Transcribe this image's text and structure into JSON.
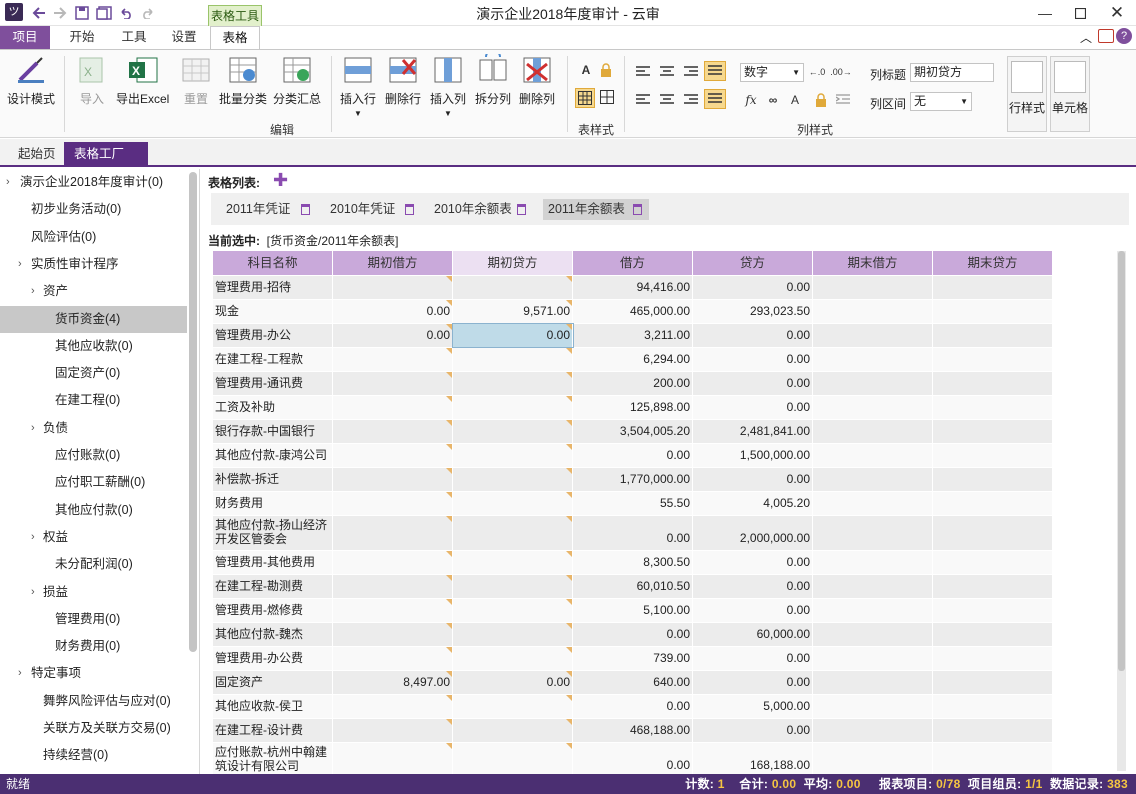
{
  "window": {
    "title": "演示企业2018年度审计 - 云审",
    "context_tab": "表格工具",
    "app_icon": "logo-icon"
  },
  "ribbon_tabs": [
    "项目",
    "开始",
    "工具",
    "设置",
    "表格"
  ],
  "ribbon": {
    "design_mode": "设计模式",
    "import": "导入",
    "export_excel": "导出Excel",
    "reset": "重置",
    "batch_classify": "批量分类",
    "classify_summary": "分类汇总",
    "insert_row": "插入行",
    "delete_row": "删除行",
    "insert_col": "插入列",
    "split_col": "拆分列",
    "delete_col": "删除列",
    "group_edit": "编辑",
    "group_table_style": "表样式",
    "group_col_style": "列样式",
    "format_select": "数字",
    "col_title_label": "列标题",
    "col_title_value": "期初贷方",
    "col_range_label": "列区间",
    "col_range_value": "无",
    "row_style": "行样式",
    "cell_style": "单元格",
    "bold_a": "A",
    "font_a": "A"
  },
  "doc_tabs": [
    "起始页",
    "表格工厂"
  ],
  "sidebar": {
    "items": [
      {
        "label": "演示企业2018年度审计(0)",
        "level": 0,
        "arrow": "›"
      },
      {
        "label": "初步业务活动(0)",
        "level": 1,
        "arrow": ""
      },
      {
        "label": "风险评估(0)",
        "level": 1,
        "arrow": ""
      },
      {
        "label": "实质性审计程序",
        "level": 1,
        "arrow": "›"
      },
      {
        "label": "资产",
        "level": 2,
        "arrow": "›"
      },
      {
        "label": "货币资金(4)",
        "level": 3,
        "arrow": "",
        "selected": true
      },
      {
        "label": "其他应收款(0)",
        "level": 3,
        "arrow": ""
      },
      {
        "label": "固定资产(0)",
        "level": 3,
        "arrow": ""
      },
      {
        "label": "在建工程(0)",
        "level": 3,
        "arrow": ""
      },
      {
        "label": "负债",
        "level": 2,
        "arrow": "›"
      },
      {
        "label": "应付账款(0)",
        "level": 3,
        "arrow": ""
      },
      {
        "label": "应付职工薪酬(0)",
        "level": 3,
        "arrow": ""
      },
      {
        "label": "其他应付款(0)",
        "level": 3,
        "arrow": ""
      },
      {
        "label": "权益",
        "level": 2,
        "arrow": "›"
      },
      {
        "label": "未分配利润(0)",
        "level": 3,
        "arrow": ""
      },
      {
        "label": "损益",
        "level": 2,
        "arrow": "›"
      },
      {
        "label": "管理费用(0)",
        "level": 3,
        "arrow": ""
      },
      {
        "label": "财务费用(0)",
        "level": 3,
        "arrow": ""
      },
      {
        "label": "特定事项",
        "level": 1,
        "arrow": "›"
      },
      {
        "label": "舞弊风险评估与应对(0)",
        "level": 2,
        "arrow": ""
      },
      {
        "label": "关联方及关联方交易(0)",
        "level": 2,
        "arrow": ""
      },
      {
        "label": "持续经营(0)",
        "level": 2,
        "arrow": ""
      }
    ]
  },
  "main": {
    "table_list_label": "表格列表:",
    "add_icon": "plus-icon",
    "table_tabs": [
      {
        "label": "2011年凭证",
        "active": false
      },
      {
        "label": "2010年凭证",
        "active": false
      },
      {
        "label": "2010年余额表",
        "active": false
      },
      {
        "label": "2011年余额表",
        "active": true
      }
    ],
    "current_label": "当前选中:",
    "current_value": "[货币资金/2011年余额表]"
  },
  "grid": {
    "columns": [
      "科目名称",
      "期初借方",
      "期初贷方",
      "借方",
      "贷方",
      "期末借方",
      "期末贷方"
    ],
    "selected_column": 2,
    "rows": [
      [
        "管理费用-招待",
        "",
        "",
        "94,416.00",
        "0.00",
        "",
        ""
      ],
      [
        "现金",
        "0.00",
        "9,571.00",
        "465,000.00",
        "293,023.50",
        "",
        ""
      ],
      [
        "管理费用-办公",
        "0.00",
        "0.00",
        "3,211.00",
        "0.00",
        "",
        ""
      ],
      [
        "在建工程-工程款",
        "",
        "",
        "6,294.00",
        "0.00",
        "",
        ""
      ],
      [
        "管理费用-通讯费",
        "",
        "",
        "200.00",
        "0.00",
        "",
        ""
      ],
      [
        "工资及补助",
        "",
        "",
        "125,898.00",
        "0.00",
        "",
        ""
      ],
      [
        "银行存款-中国银行",
        "",
        "",
        "3,504,005.20",
        "2,481,841.00",
        "",
        ""
      ],
      [
        "其他应付款-康鸿公司",
        "",
        "",
        "0.00",
        "1,500,000.00",
        "",
        ""
      ],
      [
        "补偿款-拆迁",
        "",
        "",
        "1,770,000.00",
        "0.00",
        "",
        ""
      ],
      [
        "财务费用",
        "",
        "",
        "55.50",
        "4,005.20",
        "",
        ""
      ],
      [
        "其他应付款-扬山经济开发区管委会",
        "",
        "",
        "0.00",
        "2,000,000.00",
        "",
        ""
      ],
      [
        "管理费用-其他费用",
        "",
        "",
        "8,300.50",
        "0.00",
        "",
        ""
      ],
      [
        "在建工程-勘测费",
        "",
        "",
        "60,010.50",
        "0.00",
        "",
        ""
      ],
      [
        "管理费用-燃修费",
        "",
        "",
        "5,100.00",
        "0.00",
        "",
        ""
      ],
      [
        "其他应付款-魏杰",
        "",
        "",
        "0.00",
        "60,000.00",
        "",
        ""
      ],
      [
        "管理费用-办公费",
        "",
        "",
        "739.00",
        "0.00",
        "",
        ""
      ],
      [
        "固定资产",
        "8,497.00",
        "0.00",
        "640.00",
        "0.00",
        "",
        ""
      ],
      [
        "其他应收款-侯卫",
        "",
        "",
        "0.00",
        "5,000.00",
        "",
        ""
      ],
      [
        "在建工程-设计费",
        "",
        "",
        "468,188.00",
        "0.00",
        "",
        ""
      ],
      [
        "应付账款-杭州中翰建筑设计有限公司",
        "",
        "",
        "0.00",
        "168,188.00",
        "",
        ""
      ]
    ]
  },
  "status": {
    "left": "就绪",
    "count_label": "计数:",
    "count": "1",
    "sum_label": "合计:",
    "sum": "0.00",
    "avg_label": "平均:",
    "avg": "0.00",
    "report_label": "报表项目:",
    "report": "0/78",
    "group_label": "项目组员:",
    "group": "1/1",
    "records_label": "数据记录:",
    "records": "383"
  },
  "colors": {
    "brand": "#7f4f9c",
    "header": "#c9a9da",
    "status": "#4b2f72",
    "active_cell": "#bfdbe8"
  }
}
